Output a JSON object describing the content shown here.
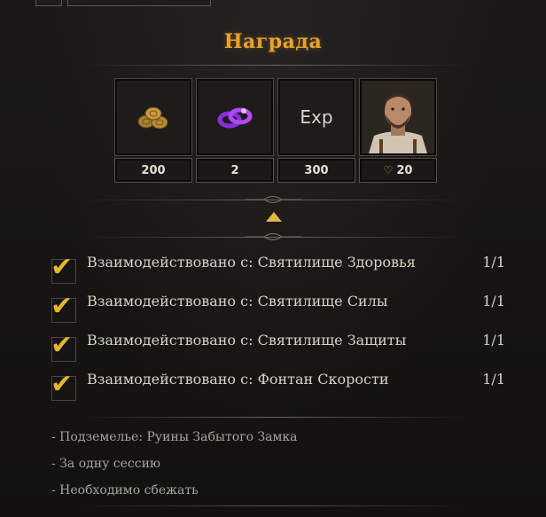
{
  "title": "Награда",
  "rewards": [
    {
      "icon": "coins-icon",
      "count": "200"
    },
    {
      "icon": "ring-icon",
      "count": "2"
    },
    {
      "icon": "exp-icon",
      "label": "Exp",
      "count": "300"
    },
    {
      "icon": "merchant-portrait",
      "count": "20",
      "count_icon": "heart-icon"
    }
  ],
  "objectives": [
    {
      "text": "Взаимодействовано с: Святилище Здоровья",
      "progress": "1/1",
      "done": true
    },
    {
      "text": "Взаимодействовано с: Святилище Силы",
      "progress": "1/1",
      "done": true
    },
    {
      "text": "Взаимодействовано с: Святилище Защиты",
      "progress": "1/1",
      "done": true
    },
    {
      "text": "Взаимодействовано с: Фонтан Скорости",
      "progress": "1/1",
      "done": true
    }
  ],
  "conditions": [
    "- Подземелье: Руины Забытого Замка",
    "- За одну сессию",
    "- Необходимо сбежать"
  ],
  "colors": {
    "accent": "#e9a22a",
    "check": "#e6b628",
    "ring": "#9b3cf0"
  }
}
